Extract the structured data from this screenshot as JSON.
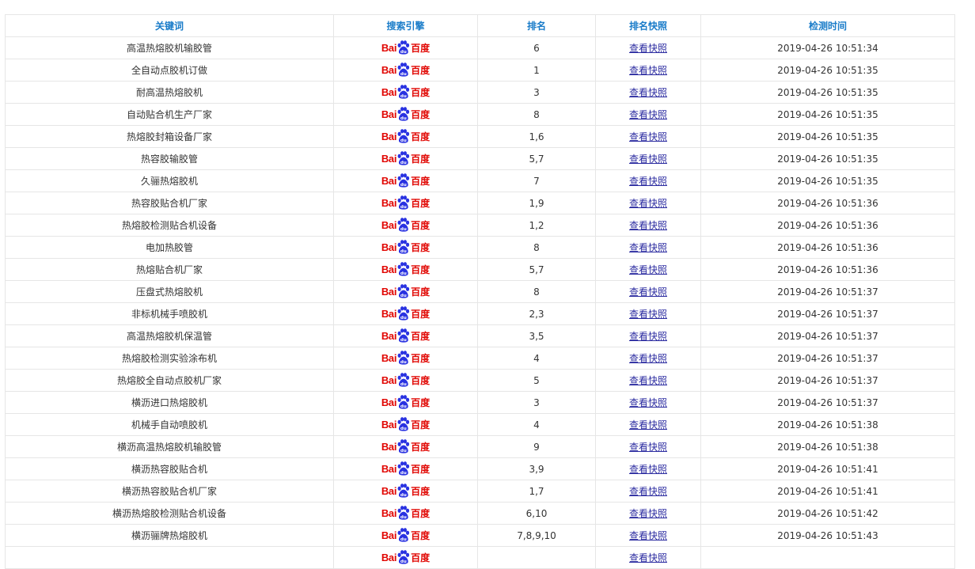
{
  "colors": {
    "header_text": "#1a7cc9",
    "baidu_red": "#e10602",
    "baidu_blue": "#2932e1",
    "link": "#2b2ba0"
  },
  "table": {
    "headers": [
      "关键词",
      "搜索引擎",
      "排名",
      "排名快照",
      "检测时间"
    ],
    "engine_logo": {
      "icon": "baidu-logo-icon",
      "text_left": "Bai",
      "text_right": "百度"
    },
    "snapshot_label": "查看快照",
    "rows": [
      {
        "keyword": "高温热熔胶机输胶管",
        "rank": "6",
        "time": "2019-04-26 10:51:34"
      },
      {
        "keyword": "全自动点胶机订做",
        "rank": "1",
        "time": "2019-04-26 10:51:35"
      },
      {
        "keyword": "耐高温热熔胶机",
        "rank": "3",
        "time": "2019-04-26 10:51:35"
      },
      {
        "keyword": "自动贴合机生产厂家",
        "rank": "8",
        "time": "2019-04-26 10:51:35"
      },
      {
        "keyword": "热熔胶封箱设备厂家",
        "rank": "1,6",
        "time": "2019-04-26 10:51:35"
      },
      {
        "keyword": "热容胶输胶管",
        "rank": "5,7",
        "time": "2019-04-26 10:51:35"
      },
      {
        "keyword": "久骊热熔胶机",
        "rank": "7",
        "time": "2019-04-26 10:51:35"
      },
      {
        "keyword": "热容胶贴合机厂家",
        "rank": "1,9",
        "time": "2019-04-26 10:51:36"
      },
      {
        "keyword": "热熔胶检测贴合机设备",
        "rank": "1,2",
        "time": "2019-04-26 10:51:36"
      },
      {
        "keyword": "电加热胶管",
        "rank": "8",
        "time": "2019-04-26 10:51:36"
      },
      {
        "keyword": "热熔贴合机厂家",
        "rank": "5,7",
        "time": "2019-04-26 10:51:36"
      },
      {
        "keyword": "压盘式热熔胶机",
        "rank": "8",
        "time": "2019-04-26 10:51:37"
      },
      {
        "keyword": "非标机械手喷胶机",
        "rank": "2,3",
        "time": "2019-04-26 10:51:37"
      },
      {
        "keyword": "高温热熔胶机保温管",
        "rank": "3,5",
        "time": "2019-04-26 10:51:37"
      },
      {
        "keyword": "热熔胶检测实验涂布机",
        "rank": "4",
        "time": "2019-04-26 10:51:37"
      },
      {
        "keyword": "热熔胶全自动点胶机厂家",
        "rank": "5",
        "time": "2019-04-26 10:51:37"
      },
      {
        "keyword": "横沥进口热熔胶机",
        "rank": "3",
        "time": "2019-04-26 10:51:37"
      },
      {
        "keyword": "机械手自动喷胶机",
        "rank": "4",
        "time": "2019-04-26 10:51:38"
      },
      {
        "keyword": "横沥高温热熔胶机输胶管",
        "rank": "9",
        "time": "2019-04-26 10:51:38"
      },
      {
        "keyword": "横沥热容胶贴合机",
        "rank": "3,9",
        "time": "2019-04-26 10:51:41"
      },
      {
        "keyword": "横沥热容胶贴合机厂家",
        "rank": "1,7",
        "time": "2019-04-26 10:51:41"
      },
      {
        "keyword": "横沥热熔胶检测贴合机设备",
        "rank": "6,10",
        "time": "2019-04-26 10:51:42"
      },
      {
        "keyword": "横沥骊牌热熔胶机",
        "rank": "7,8,9,10",
        "time": "2019-04-26 10:51:43"
      },
      {
        "keyword": "",
        "rank": "",
        "time": ""
      }
    ]
  }
}
